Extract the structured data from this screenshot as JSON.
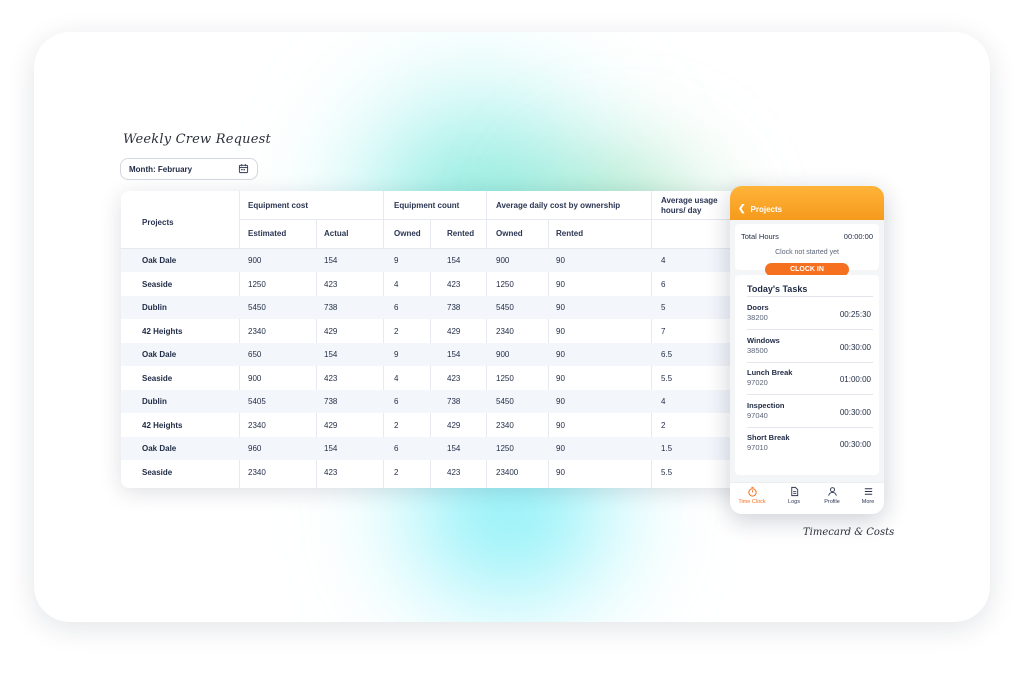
{
  "colors": {
    "accent": "#f5701f",
    "header_orange": "#f7a325",
    "row_alt": "#f3f6fb",
    "glow_teal": "#5fe2d6"
  },
  "title": "Weekly Crew Request",
  "month_picker": {
    "label": "Month: February",
    "icon": "calendar-icon"
  },
  "table": {
    "group_headers": [
      "Projects",
      "Equipment cost",
      "Equipment count",
      "Average daily cost by ownership",
      "Average usage",
      "hours/ day"
    ],
    "sub_headers": [
      "Estimated",
      "Actual",
      "Owned",
      "Rented",
      "Owned",
      "Rented"
    ],
    "rows": [
      [
        "Oak Dale",
        "900",
        "154",
        "9",
        "154",
        "900",
        "90",
        "4"
      ],
      [
        "Seaside",
        "1250",
        "423",
        "4",
        "423",
        "1250",
        "90",
        "6"
      ],
      [
        "Dublin",
        "5450",
        "738",
        "6",
        "738",
        "5450",
        "90",
        "5"
      ],
      [
        "42 Heights",
        "2340",
        "429",
        "2",
        "429",
        "2340",
        "90",
        "7"
      ],
      [
        "Oak Dale",
        "650",
        "154",
        "9",
        "154",
        "900",
        "90",
        "6.5"
      ],
      [
        "Seaside",
        "900",
        "423",
        "4",
        "423",
        "1250",
        "90",
        "5.5"
      ],
      [
        "Dublin",
        "5405",
        "738",
        "6",
        "738",
        "5450",
        "90",
        "4"
      ],
      [
        "42 Heights",
        "2340",
        "429",
        "2",
        "429",
        "2340",
        "90",
        "2"
      ],
      [
        "Oak Dale",
        "960",
        "154",
        "6",
        "154",
        "1250",
        "90",
        "1.5"
      ],
      [
        "Seaside",
        "2340",
        "423",
        "2",
        "423",
        "23400",
        "90",
        "5.5"
      ]
    ]
  },
  "phone": {
    "header": {
      "back_label": "Projects"
    },
    "hours": {
      "label": "Total Hours",
      "value": "00:00:00",
      "status": "Clock not started yet",
      "button": "CLOCK IN"
    },
    "tasks_title": "Today's Tasks",
    "tasks": [
      {
        "name": "Doors",
        "code": "38200",
        "duration": "00:25:30"
      },
      {
        "name": "Windows",
        "code": "38500",
        "duration": "00:30:00"
      },
      {
        "name": "Lunch Break",
        "code": "97020",
        "duration": "01:00:00"
      },
      {
        "name": "Inspection",
        "code": "97040",
        "duration": "00:30:00"
      },
      {
        "name": "Short Break",
        "code": "97010",
        "duration": "00:30:00"
      }
    ],
    "tabs": [
      {
        "label": "Time Clock",
        "icon": "stopwatch-icon"
      },
      {
        "label": "Logs",
        "icon": "document-icon"
      },
      {
        "label": "Profile",
        "icon": "person-icon"
      },
      {
        "label": "More",
        "icon": "menu-icon"
      }
    ]
  },
  "caption": "Timecard & Costs"
}
